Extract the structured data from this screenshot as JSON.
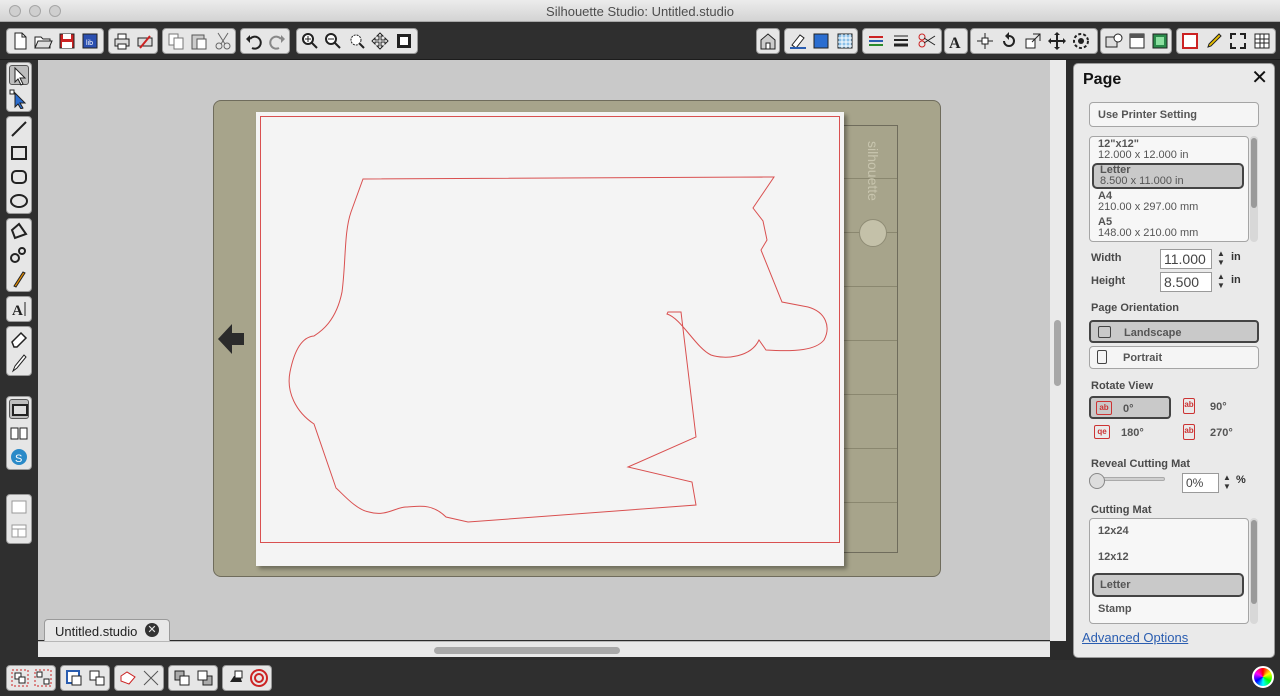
{
  "window": {
    "title": "Silhouette Studio: Untitled.studio"
  },
  "document_tab": {
    "label": "Untitled.studio"
  },
  "mat": {
    "brand": "silhouette"
  },
  "toolbar": {
    "file_icons": [
      "new-file-icon",
      "open-file-icon",
      "save-icon",
      "library-save-icon"
    ],
    "print_icons": [
      "print-icon",
      "print-cut-icon"
    ],
    "edit_icons": [
      "copy-icon",
      "paste-icon",
      "cut-icon"
    ],
    "history_icons": [
      "undo-icon",
      "redo-icon"
    ],
    "zoom_icons": [
      "zoom-in-icon",
      "zoom-out-icon",
      "zoom-select-icon",
      "pan-icon",
      "fit-page-icon"
    ]
  },
  "page_panel": {
    "title": "Page",
    "use_printer_setting": "Use Printer Setting",
    "page_sizes": [
      {
        "name": "12\"x12\"",
        "dims": "12.000 x 12.000 in"
      },
      {
        "name": "Letter",
        "dims": "8.500 x 11.000 in",
        "selected": true
      },
      {
        "name": "A4",
        "dims": "210.00 x 297.00 mm"
      },
      {
        "name": "A5",
        "dims": "148.00 x 210.00 mm"
      }
    ],
    "width_label": "Width",
    "width_value": "11.000",
    "height_label": "Height",
    "height_value": "8.500",
    "unit": "in",
    "orientation_label": "Page Orientation",
    "orientation_landscape": "Landscape",
    "orientation_portrait": "Portrait",
    "orientation_selected": "Landscape",
    "rotate_label": "Rotate View",
    "rotate_0": "0°",
    "rotate_90": "90°",
    "rotate_180": "180°",
    "rotate_270": "270°",
    "rotate_selected": "0°",
    "reveal_label": "Reveal Cutting Mat",
    "reveal_value": "0%",
    "reveal_unit": "%",
    "mat_label": "Cutting Mat",
    "mats": [
      "12x24",
      "12x12",
      "Letter",
      "Stamp"
    ],
    "mat_selected": "Letter",
    "advanced_options": "Advanced Options"
  },
  "colors": {
    "cut_line": "#d95050",
    "mat": "#a7a48b",
    "canvas": "#c9c9c9"
  }
}
